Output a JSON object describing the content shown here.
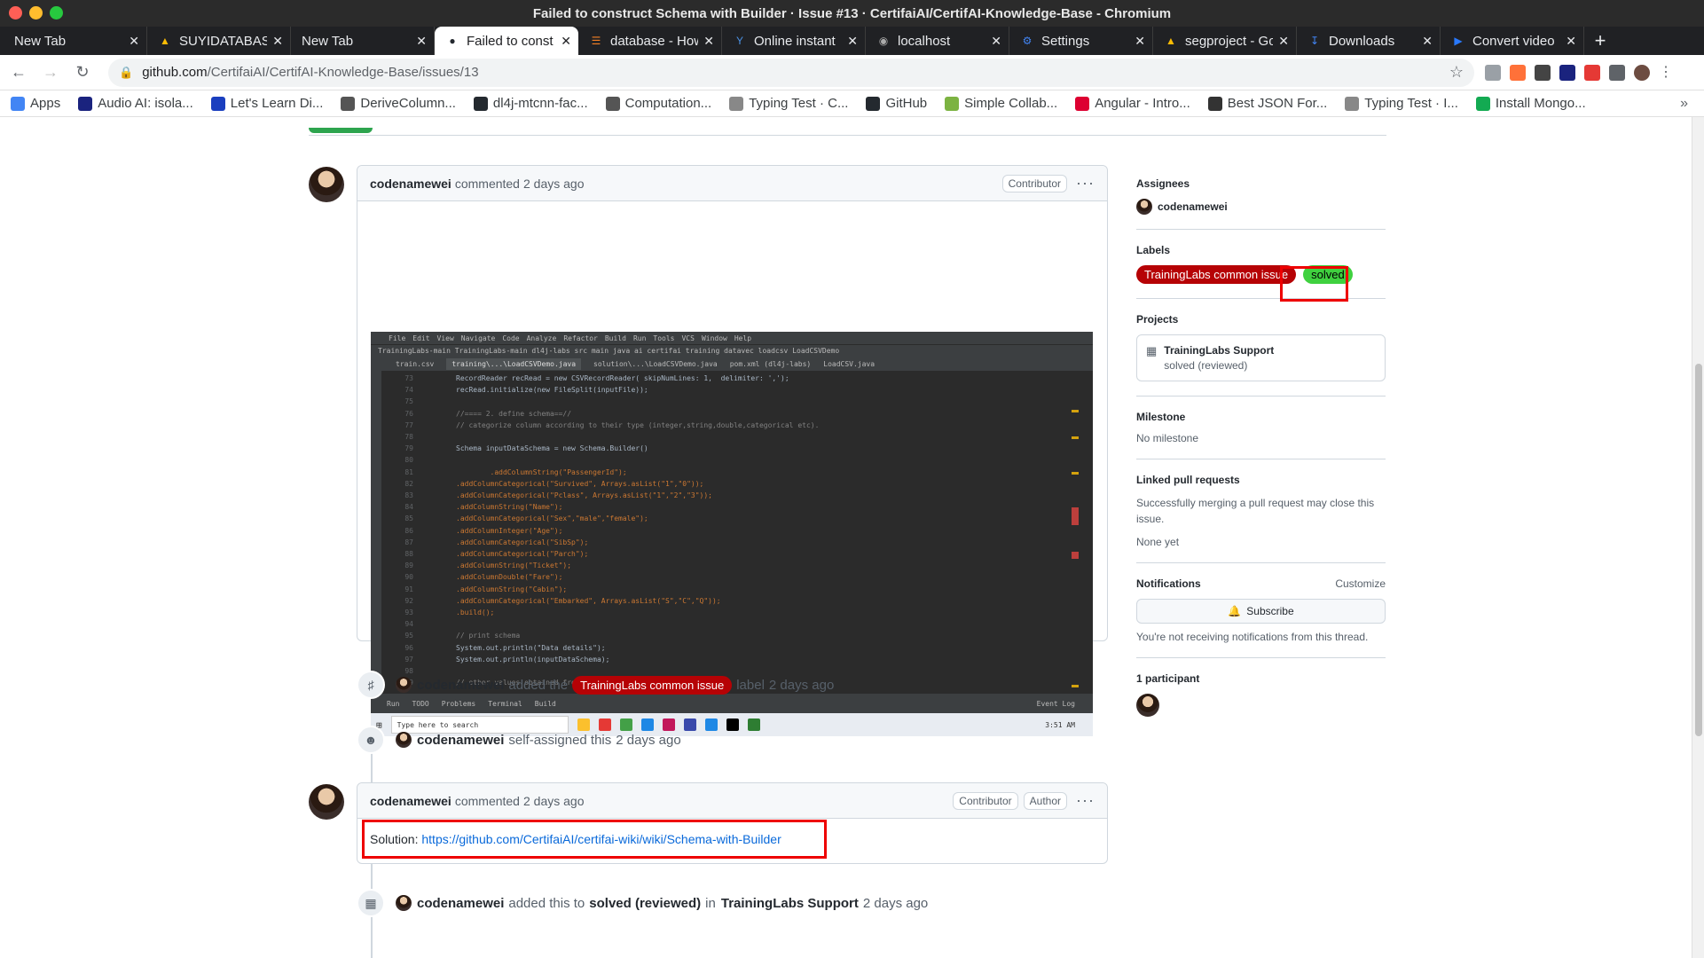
{
  "window": {
    "title": "Failed to construct Schema with Builder · Issue #13 · CertifaiAI/CertifAI-Knowledge-Base - Chromium"
  },
  "tabs": [
    {
      "label": "New Tab",
      "icon": "",
      "active": false
    },
    {
      "label": "SUYIDATABASE",
      "icon": "drive-icon",
      "active": false
    },
    {
      "label": "New Tab",
      "icon": "",
      "active": false
    },
    {
      "label": "Failed to const",
      "icon": "github-icon",
      "active": true
    },
    {
      "label": "database - How",
      "icon": "stackoverflow-icon",
      "active": false
    },
    {
      "label": "Online instant",
      "icon": "y-icon",
      "active": false
    },
    {
      "label": "localhost",
      "icon": "globe-icon",
      "active": false
    },
    {
      "label": "Settings",
      "icon": "gear-icon",
      "active": false
    },
    {
      "label": "segproject - Go",
      "icon": "drive-icon",
      "active": false
    },
    {
      "label": "Downloads",
      "icon": "download-icon",
      "active": false
    },
    {
      "label": "Convert video",
      "icon": "convert-icon",
      "active": false
    }
  ],
  "address": {
    "host": "github.com",
    "path": "/CertifaiAI/CertifAI-Knowledge-Base/issues/13"
  },
  "bookmarks": [
    {
      "label": "Apps",
      "color": "#4285f4"
    },
    {
      "label": "Audio AI: isola...",
      "color": "#1a237e"
    },
    {
      "label": "Let's Learn Di...",
      "color": "#1a3fbf"
    },
    {
      "label": "DeriveColumn...",
      "color": "#555555"
    },
    {
      "label": "dl4j-mtcnn-fac...",
      "color": "#24292f"
    },
    {
      "label": "Computation...",
      "color": "#555555"
    },
    {
      "label": "Typing Test · C...",
      "color": "#888888"
    },
    {
      "label": "GitHub",
      "color": "#24292f"
    },
    {
      "label": "Simple Collab...",
      "color": "#7cb342"
    },
    {
      "label": "Angular - Intro...",
      "color": "#dd0031"
    },
    {
      "label": "Best JSON For...",
      "color": "#333333"
    },
    {
      "label": "Typing Test · I...",
      "color": "#888888"
    },
    {
      "label": "Install Mongo...",
      "color": "#13aa52"
    }
  ],
  "comment1": {
    "author": "codenamewei",
    "action": "commented",
    "time": "2 days ago",
    "badge": "Contributor"
  },
  "ide": {
    "menu": [
      "File",
      "Edit",
      "View",
      "Navigate",
      "Code",
      "Analyze",
      "Refactor",
      "Build",
      "Run",
      "Tools",
      "VCS",
      "Window",
      "Help"
    ],
    "breadcrumb": "TrainingLabs-main  TrainingLabs-main  dl4j-labs  src  main  java  ai  certifai  training  datavec  loadcsv  LoadCSVDemo",
    "tabs": [
      "train.csv",
      "training\\...\\LoadCSVDemo.java",
      "solution\\...\\LoadCSVDemo.java",
      "pom.xml (dl4j-labs)",
      "LoadCSV.java"
    ],
    "lines": [
      {
        "n": "73",
        "code": "RecordReader recRead = new CSVRecordReader( skipNumLines: 1,  delimiter: ',');"
      },
      {
        "n": "74",
        "code": "recRead.initialize(new FileSplit(inputFile));"
      },
      {
        "n": "75",
        "code": ""
      },
      {
        "n": "76",
        "code": "//==== 2. define schema==//"
      },
      {
        "n": "77",
        "code": "// categorize column according to their type (integer,string,double,categorical etc)."
      },
      {
        "n": "78",
        "code": ""
      },
      {
        "n": "79",
        "code": "Schema inputDataSchema = new Schema.Builder()"
      },
      {
        "n": "80",
        "code": ""
      },
      {
        "n": "81",
        "code": "        .addColumnString(\"PassengerId\");"
      },
      {
        "n": "82",
        "code": ".addColumnCategorical(\"Survived\", Arrays.asList(\"1\",\"0\"));"
      },
      {
        "n": "83",
        "code": ".addColumnCategorical(\"Pclass\", Arrays.asList(\"1\",\"2\",\"3\"));"
      },
      {
        "n": "84",
        "code": ".addColumnString(\"Name\");"
      },
      {
        "n": "85",
        "code": ".addColumnCategorical(\"Sex\",\"male\",\"female\");"
      },
      {
        "n": "86",
        "code": ".addColumnInteger(\"Age\");"
      },
      {
        "n": "87",
        "code": ".addColumnCategorical(\"SibSp\");"
      },
      {
        "n": "88",
        "code": ".addColumnCategorical(\"Parch\");"
      },
      {
        "n": "89",
        "code": ".addColumnString(\"Ticket\");"
      },
      {
        "n": "90",
        "code": ".addColumnDouble(\"Fare\");"
      },
      {
        "n": "91",
        "code": ".addColumnString(\"Cabin\");"
      },
      {
        "n": "92",
        "code": ".addColumnCategorical(\"Embarked\", Arrays.asList(\"S\",\"C\",\"Q\"));"
      },
      {
        "n": "93",
        "code": ".build();"
      },
      {
        "n": "94",
        "code": ""
      },
      {
        "n": "95",
        "code": "// print schema"
      },
      {
        "n": "96",
        "code": "System.out.println(\"Data details\");"
      },
      {
        "n": "97",
        "code": "System.out.println(inputDataSchema);"
      },
      {
        "n": "98",
        "code": ""
      },
      {
        "n": "99",
        "code": "// other values obtained from schema that might be useful"
      }
    ],
    "status_items": [
      "Run",
      "TODO",
      "Problems",
      "Terminal",
      "Build"
    ],
    "status_right": "Event Log",
    "taskbar_search": "Type here to search",
    "clock": "3:51 AM"
  },
  "timeline": {
    "label_event": {
      "actor": "codenamewei",
      "verb": "added the",
      "label": "TrainingLabs common issue",
      "suffix": "label",
      "time": "2 days ago"
    },
    "assign_event": {
      "actor": "codenamewei",
      "verb": "self-assigned this",
      "time": "2 days ago"
    },
    "project_event": {
      "actor": "codenamewei",
      "verb": "added this to",
      "column": "solved (reviewed)",
      "in": "in",
      "project": "TrainingLabs Support",
      "time": "2 days ago"
    }
  },
  "comment2": {
    "author": "codenamewei",
    "action": "commented",
    "time": "2 days ago",
    "badge1": "Contributor",
    "badge2": "Author",
    "body_prefix": "Solution:",
    "link": "https://github.com/CertifaiAI/certifai-wiki/wiki/Schema-with-Builder"
  },
  "sidebar": {
    "assignees_title": "Assignees",
    "assignee": "codenamewei",
    "labels_title": "Labels",
    "labels": [
      "TrainingLabs common issue",
      "solved"
    ],
    "projects_title": "Projects",
    "project_name": "TrainingLabs Support",
    "project_status": "solved (reviewed)",
    "milestone_title": "Milestone",
    "milestone_value": "No milestone",
    "linked_title": "Linked pull requests",
    "linked_desc": "Successfully merging a pull request may close this issue.",
    "linked_none": "None yet",
    "notifications_title": "Notifications",
    "customize": "Customize",
    "subscribe": "Subscribe",
    "notif_desc": "You're not receiving notifications from this thread.",
    "participants": "1 participant"
  }
}
